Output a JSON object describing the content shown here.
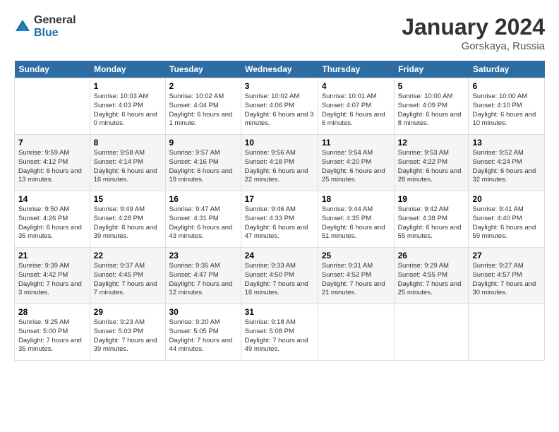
{
  "logo": {
    "general": "General",
    "blue": "Blue"
  },
  "title": "January 2024",
  "location": "Gorskaya, Russia",
  "days_header": [
    "Sunday",
    "Monday",
    "Tuesday",
    "Wednesday",
    "Thursday",
    "Friday",
    "Saturday"
  ],
  "weeks": [
    [
      {
        "day": "",
        "sunrise": "",
        "sunset": "",
        "daylight": ""
      },
      {
        "day": "1",
        "sunrise": "10:03 AM",
        "sunset": "4:03 PM",
        "daylight": "6 hours and 0 minutes."
      },
      {
        "day": "2",
        "sunrise": "10:02 AM",
        "sunset": "4:04 PM",
        "daylight": "6 hours and 1 minute."
      },
      {
        "day": "3",
        "sunrise": "10:02 AM",
        "sunset": "4:06 PM",
        "daylight": "6 hours and 3 minutes."
      },
      {
        "day": "4",
        "sunrise": "10:01 AM",
        "sunset": "4:07 PM",
        "daylight": "6 hours and 6 minutes."
      },
      {
        "day": "5",
        "sunrise": "10:00 AM",
        "sunset": "4:09 PM",
        "daylight": "6 hours and 8 minutes."
      },
      {
        "day": "6",
        "sunrise": "10:00 AM",
        "sunset": "4:10 PM",
        "daylight": "6 hours and 10 minutes."
      }
    ],
    [
      {
        "day": "7",
        "sunrise": "9:59 AM",
        "sunset": "4:12 PM",
        "daylight": "6 hours and 13 minutes."
      },
      {
        "day": "8",
        "sunrise": "9:58 AM",
        "sunset": "4:14 PM",
        "daylight": "6 hours and 16 minutes."
      },
      {
        "day": "9",
        "sunrise": "9:57 AM",
        "sunset": "4:16 PM",
        "daylight": "6 hours and 19 minutes."
      },
      {
        "day": "10",
        "sunrise": "9:56 AM",
        "sunset": "4:18 PM",
        "daylight": "6 hours and 22 minutes."
      },
      {
        "day": "11",
        "sunrise": "9:54 AM",
        "sunset": "4:20 PM",
        "daylight": "6 hours and 25 minutes."
      },
      {
        "day": "12",
        "sunrise": "9:53 AM",
        "sunset": "4:22 PM",
        "daylight": "6 hours and 28 minutes."
      },
      {
        "day": "13",
        "sunrise": "9:52 AM",
        "sunset": "4:24 PM",
        "daylight": "6 hours and 32 minutes."
      }
    ],
    [
      {
        "day": "14",
        "sunrise": "9:50 AM",
        "sunset": "4:26 PM",
        "daylight": "6 hours and 35 minutes."
      },
      {
        "day": "15",
        "sunrise": "9:49 AM",
        "sunset": "4:28 PM",
        "daylight": "6 hours and 39 minutes."
      },
      {
        "day": "16",
        "sunrise": "9:47 AM",
        "sunset": "4:31 PM",
        "daylight": "6 hours and 43 minutes."
      },
      {
        "day": "17",
        "sunrise": "9:46 AM",
        "sunset": "4:33 PM",
        "daylight": "6 hours and 47 minutes."
      },
      {
        "day": "18",
        "sunrise": "9:44 AM",
        "sunset": "4:35 PM",
        "daylight": "6 hours and 51 minutes."
      },
      {
        "day": "19",
        "sunrise": "9:42 AM",
        "sunset": "4:38 PM",
        "daylight": "6 hours and 55 minutes."
      },
      {
        "day": "20",
        "sunrise": "9:41 AM",
        "sunset": "4:40 PM",
        "daylight": "6 hours and 59 minutes."
      }
    ],
    [
      {
        "day": "21",
        "sunrise": "9:39 AM",
        "sunset": "4:42 PM",
        "daylight": "7 hours and 3 minutes."
      },
      {
        "day": "22",
        "sunrise": "9:37 AM",
        "sunset": "4:45 PM",
        "daylight": "7 hours and 7 minutes."
      },
      {
        "day": "23",
        "sunrise": "9:35 AM",
        "sunset": "4:47 PM",
        "daylight": "7 hours and 12 minutes."
      },
      {
        "day": "24",
        "sunrise": "9:33 AM",
        "sunset": "4:50 PM",
        "daylight": "7 hours and 16 minutes."
      },
      {
        "day": "25",
        "sunrise": "9:31 AM",
        "sunset": "4:52 PM",
        "daylight": "7 hours and 21 minutes."
      },
      {
        "day": "26",
        "sunrise": "9:29 AM",
        "sunset": "4:55 PM",
        "daylight": "7 hours and 25 minutes."
      },
      {
        "day": "27",
        "sunrise": "9:27 AM",
        "sunset": "4:57 PM",
        "daylight": "7 hours and 30 minutes."
      }
    ],
    [
      {
        "day": "28",
        "sunrise": "9:25 AM",
        "sunset": "5:00 PM",
        "daylight": "7 hours and 35 minutes."
      },
      {
        "day": "29",
        "sunrise": "9:23 AM",
        "sunset": "5:03 PM",
        "daylight": "7 hours and 39 minutes."
      },
      {
        "day": "30",
        "sunrise": "9:20 AM",
        "sunset": "5:05 PM",
        "daylight": "7 hours and 44 minutes."
      },
      {
        "day": "31",
        "sunrise": "9:18 AM",
        "sunset": "5:08 PM",
        "daylight": "7 hours and 49 minutes."
      },
      {
        "day": "",
        "sunrise": "",
        "sunset": "",
        "daylight": ""
      },
      {
        "day": "",
        "sunrise": "",
        "sunset": "",
        "daylight": ""
      },
      {
        "day": "",
        "sunrise": "",
        "sunset": "",
        "daylight": ""
      }
    ]
  ]
}
